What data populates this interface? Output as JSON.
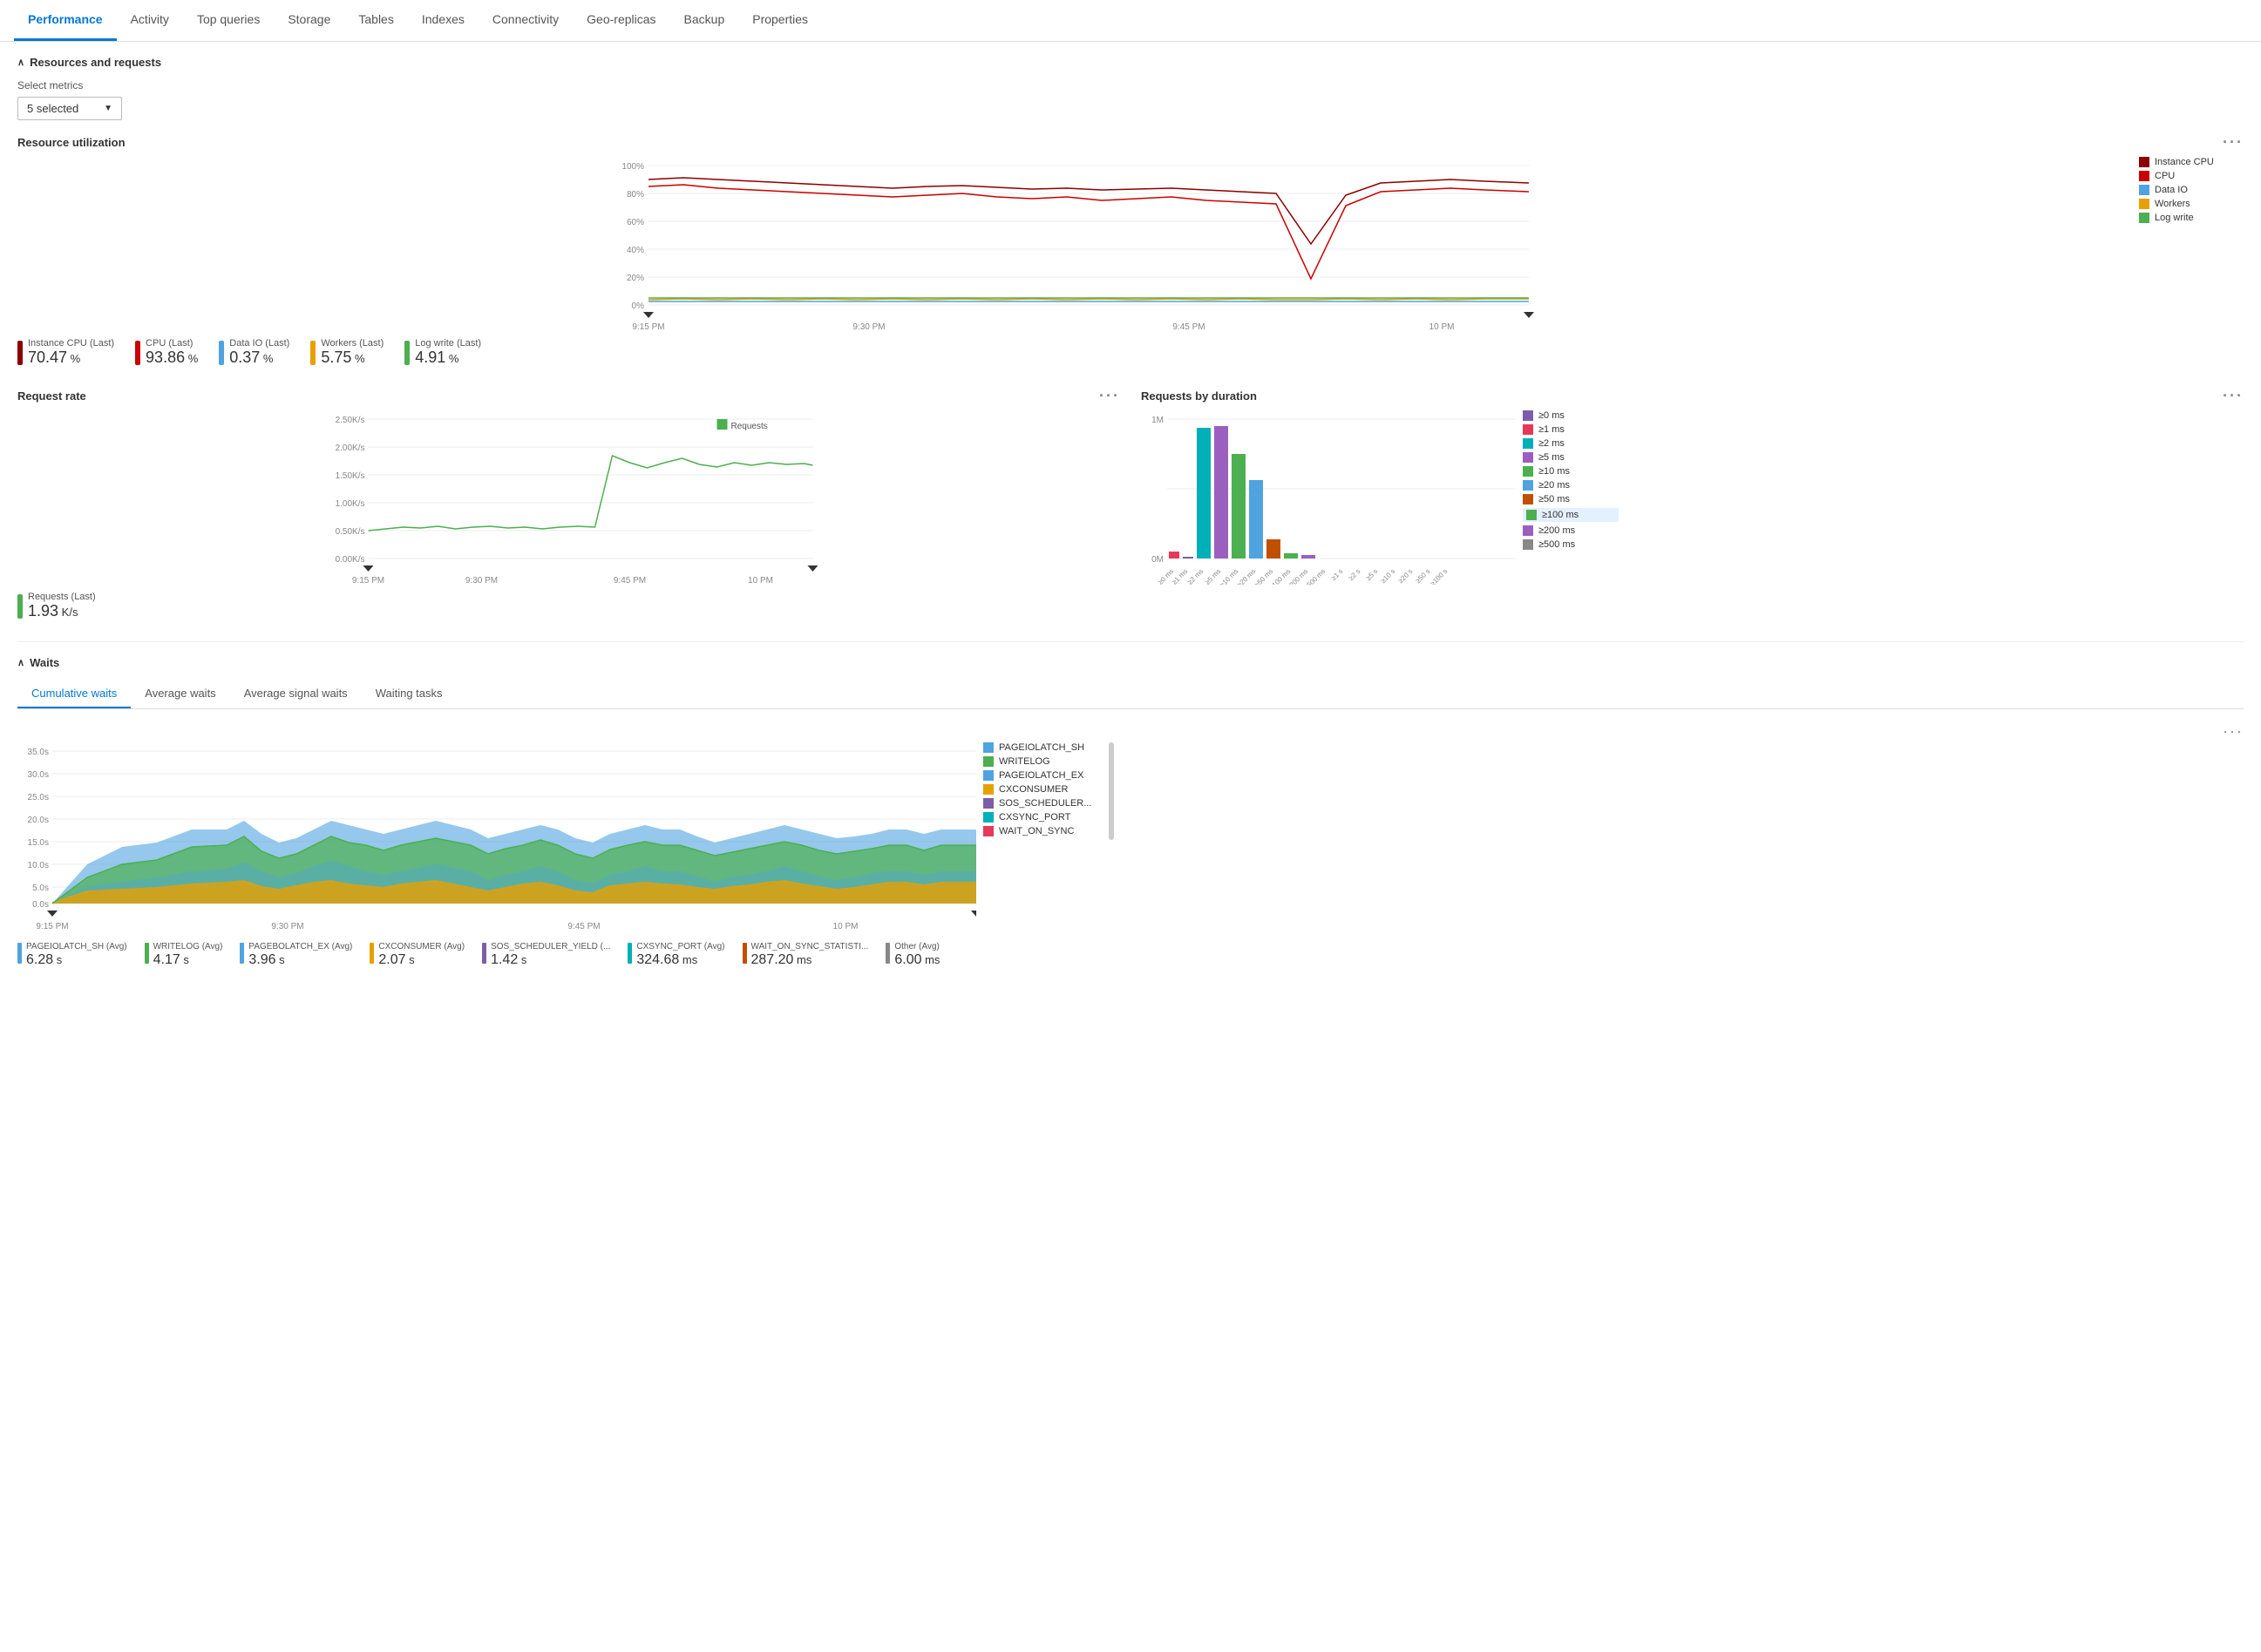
{
  "tabs": [
    {
      "label": "Performance",
      "active": true
    },
    {
      "label": "Activity",
      "active": false
    },
    {
      "label": "Top queries",
      "active": false
    },
    {
      "label": "Storage",
      "active": false
    },
    {
      "label": "Tables",
      "active": false
    },
    {
      "label": "Indexes",
      "active": false
    },
    {
      "label": "Connectivity",
      "active": false
    },
    {
      "label": "Geo-replicas",
      "active": false
    },
    {
      "label": "Backup",
      "active": false
    },
    {
      "label": "Properties",
      "active": false
    }
  ],
  "sections": {
    "resources": {
      "title": "Resources and requests",
      "select_label": "Select metrics",
      "selected_value": "5 selected"
    },
    "resource_utilization": {
      "title": "Resource utilization",
      "y_labels": [
        "100%",
        "80%",
        "60%",
        "40%",
        "20%",
        "0%"
      ],
      "x_labels": [
        "9:15 PM",
        "9:30 PM",
        "9:45 PM",
        "10 PM"
      ],
      "legend": [
        {
          "label": "Instance CPU",
          "color": "#c00000"
        },
        {
          "label": "CPU",
          "color": "#e00000"
        },
        {
          "label": "Data IO",
          "color": "#4fa3e0"
        },
        {
          "label": "Workers",
          "color": "#e8a000"
        },
        {
          "label": "Log write",
          "color": "#4caf50"
        }
      ],
      "metrics": [
        {
          "label": "Instance CPU (Last)",
          "color": "#c00000",
          "value": "70.47",
          "unit": "%"
        },
        {
          "label": "CPU (Last)",
          "color": "#e00000",
          "value": "93.86",
          "unit": "%"
        },
        {
          "label": "Data IO (Last)",
          "color": "#4fa3e0",
          "value": "0.37",
          "unit": "%"
        },
        {
          "label": "Workers (Last)",
          "color": "#e8a000",
          "value": "5.75",
          "unit": "%"
        },
        {
          "label": "Log write (Last)",
          "color": "#4caf50",
          "value": "4.91",
          "unit": "%"
        }
      ]
    },
    "request_rate": {
      "title": "Request rate",
      "y_labels": [
        "2.50K/s",
        "2.00K/s",
        "1.50K/s",
        "1.00K/s",
        "0.50K/s",
        "0.00K/s"
      ],
      "x_labels": [
        "9:15 PM",
        "9:30 PM",
        "9:45 PM",
        "10 PM"
      ],
      "legend_label": "Requests",
      "legend_color": "#4caf50",
      "metric_label": "Requests (Last)",
      "metric_value": "1.93",
      "metric_unit": "K/s",
      "metric_color": "#4caf50"
    },
    "requests_by_duration": {
      "title": "Requests by duration",
      "y_labels": [
        "1M",
        "0M"
      ],
      "x_labels": [
        "≥0 ms",
        "≥1 ms",
        "≥2 ms",
        "≥5 ms",
        "≥10 ms",
        "≥20 ms",
        "≥50 ms",
        "≥100 ms",
        "≥200 ms",
        "≥500 ms",
        "≥1 s",
        "≥2 s",
        "≥5 s",
        "≥10 s",
        "≥20 s",
        "≥50 s",
        "≥100 s"
      ],
      "legend": [
        {
          "label": "≥0 ms",
          "color": "#7b5ea7"
        },
        {
          "label": "≥1 ms",
          "color": "#e8385a"
        },
        {
          "label": "≥2 ms",
          "color": "#00b0b9"
        },
        {
          "label": "≥5 ms",
          "color": "#9b5fc0"
        },
        {
          "label": "≥10 ms",
          "color": "#4caf50"
        },
        {
          "label": "≥20 ms",
          "color": "#4fa3e0"
        },
        {
          "label": "≥50 ms",
          "color": "#c05000"
        },
        {
          "label": "≥100 ms",
          "color": "#4caf50",
          "highlighted": true
        },
        {
          "label": "≥200 ms",
          "color": "#9b5fc0"
        },
        {
          "label": "≥500 ms",
          "color": "#888888"
        }
      ]
    },
    "waits": {
      "title": "Waits",
      "tabs": [
        "Cumulative waits",
        "Average waits",
        "Average signal waits",
        "Waiting tasks"
      ],
      "active_tab": 0,
      "y_labels": [
        "35.0s",
        "30.0s",
        "25.0s",
        "20.0s",
        "15.0s",
        "10.0s",
        "5.0s",
        "0.0s"
      ],
      "x_labels": [
        "9:15 PM",
        "9:30 PM",
        "9:45 PM",
        "10 PM"
      ],
      "legend": [
        {
          "label": "PAGEIOLATCH_SH",
          "color": "#4fa3e0"
        },
        {
          "label": "WRITELOG",
          "color": "#4caf50"
        },
        {
          "label": "PAGEIOLATCH_EX",
          "color": "#4fa3e0"
        },
        {
          "label": "CXCONSUMER",
          "color": "#e8a000"
        },
        {
          "label": "SOS_SCHEDULER...",
          "color": "#7b5ea7"
        },
        {
          "label": "CXSYNC_PORT",
          "color": "#00b0b9"
        },
        {
          "label": "WAIT_ON_SYNC",
          "color": "#e8385a"
        }
      ],
      "bottom_metrics": [
        {
          "label": "PAGEIOLATCH_SH (Avg)",
          "color": "#4fa3e0",
          "value": "6.28",
          "unit": "s"
        },
        {
          "label": "WRITELOG (Avg)",
          "color": "#4caf50",
          "value": "4.17",
          "unit": "s"
        },
        {
          "label": "PAGEBOLATCH_EX (Avg)",
          "color": "#4fa3e0",
          "value": "3.96",
          "unit": "s"
        },
        {
          "label": "CXCONSUMER (Avg)",
          "color": "#e8a000",
          "value": "2.07",
          "unit": "s"
        },
        {
          "label": "SOS_SCHEDULER_YIELD (...",
          "color": "#7b5ea7",
          "value": "1.42",
          "unit": "s"
        },
        {
          "label": "CXSYNC_PORT (Avg)",
          "color": "#00b0b9",
          "value": "324.68",
          "unit": "ms"
        },
        {
          "label": "WAIT_ON_SYNC_STATISTI...",
          "color": "#c05000",
          "value": "287.20",
          "unit": "ms"
        },
        {
          "label": "Other (Avg)",
          "color": "#888888",
          "value": "6.00",
          "unit": "ms"
        }
      ]
    }
  }
}
